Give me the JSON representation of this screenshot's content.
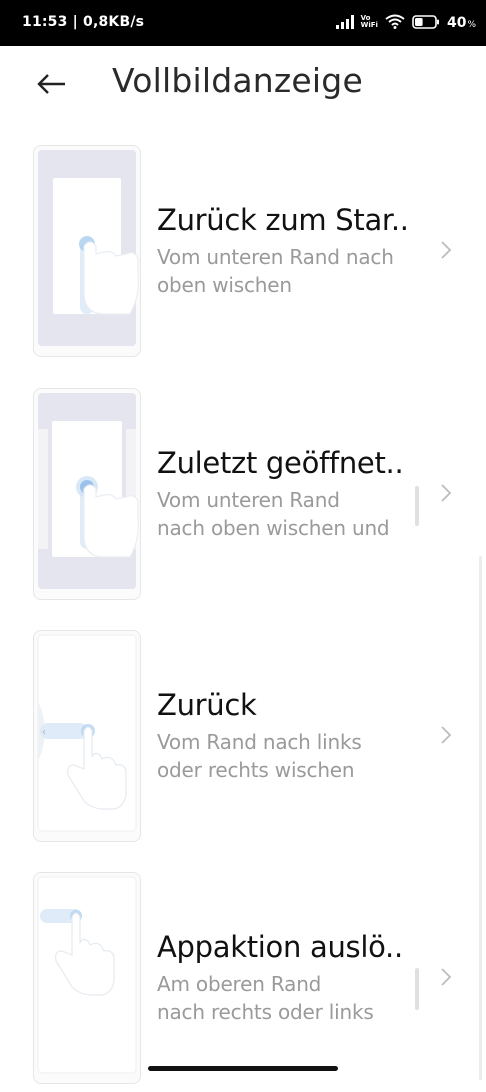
{
  "status": {
    "time_speed": "11:53 | 0,8KB/s",
    "vo_top": "Vo",
    "vo_bottom": "WiFi",
    "battery": "40",
    "battery_unit": "%",
    "battery_level": 0.4
  },
  "header": {
    "back_icon": "arrow-left-icon",
    "title": "Vollbildanzeige"
  },
  "items": [
    {
      "title": "Zurück zum Star..",
      "subtitle_line1": "Vom unteren Rand nach",
      "subtitle_line2": "oben wischen"
    },
    {
      "title": "Zuletzt geöffnet..",
      "subtitle_line1": "Vom unteren Rand",
      "subtitle_line2": "nach oben wischen und"
    },
    {
      "title": "Zurück",
      "subtitle_line1": "Vom Rand nach links",
      "subtitle_line2": "oder rechts wischen"
    },
    {
      "title": "Appaktion auslö..",
      "subtitle_line1": "Am oberen Rand",
      "subtitle_line2": "nach rechts oder links"
    }
  ],
  "colors": {
    "title": "#2a2a2a",
    "subtitle": "#9a9a9a",
    "thumb_bg": "#e4e5ee",
    "touch_blue": "#8fbce8"
  }
}
